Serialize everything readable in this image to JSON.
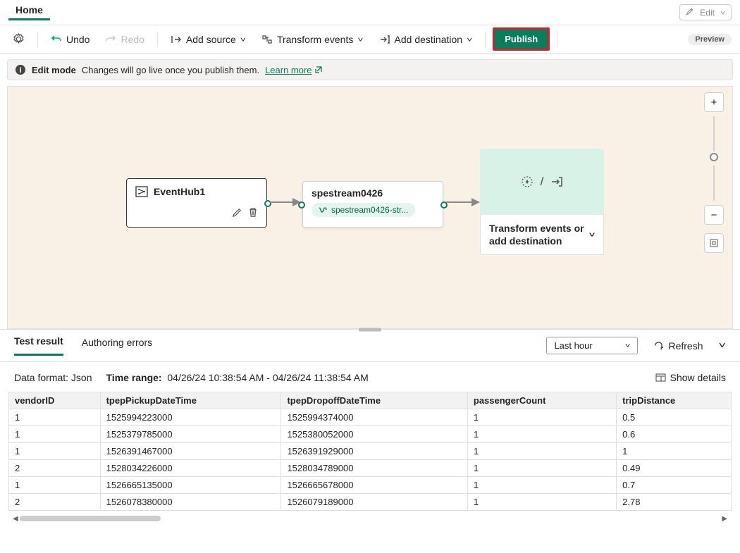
{
  "header": {
    "home": "Home",
    "edit": "Edit"
  },
  "toolbar": {
    "undo": "Undo",
    "redo": "Redo",
    "add_source": "Add source",
    "transform_events": "Transform events",
    "add_destination": "Add destination",
    "publish": "Publish",
    "preview": "Preview"
  },
  "infobar": {
    "mode": "Edit mode",
    "msg": "Changes will go live once you publish them.",
    "learn": "Learn more"
  },
  "canvas": {
    "source_name": "EventHub1",
    "mid_name": "spestream0426",
    "mid_pill": "spestream0426-str...",
    "dest_label": "Transform events or add destination",
    "slash": "/"
  },
  "results": {
    "tab_test": "Test result",
    "tab_errors": "Authoring errors",
    "time_select": "Last hour",
    "refresh": "Refresh",
    "data_format_label": "Data format:",
    "data_format_value": "Json",
    "time_range_label": "Time range:",
    "time_range_value": "04/26/24 10:38:54 AM - 04/26/24 11:38:54 AM",
    "show_details": "Show details",
    "columns": [
      "vendorID",
      "tpepPickupDateTime",
      "tpepDropoffDateTime",
      "passengerCount",
      "tripDistance"
    ],
    "rows": [
      [
        "1",
        "1525994223000",
        "1525994374000",
        "1",
        "0.5"
      ],
      [
        "1",
        "1525379785000",
        "1525380052000",
        "1",
        "0.6"
      ],
      [
        "1",
        "1526391467000",
        "1526391929000",
        "1",
        "1"
      ],
      [
        "2",
        "1528034226000",
        "1528034789000",
        "1",
        "0.49"
      ],
      [
        "1",
        "1526665135000",
        "1526665678000",
        "1",
        "0.7"
      ],
      [
        "2",
        "1526078380000",
        "1526079189000",
        "1",
        "2.78"
      ]
    ]
  }
}
